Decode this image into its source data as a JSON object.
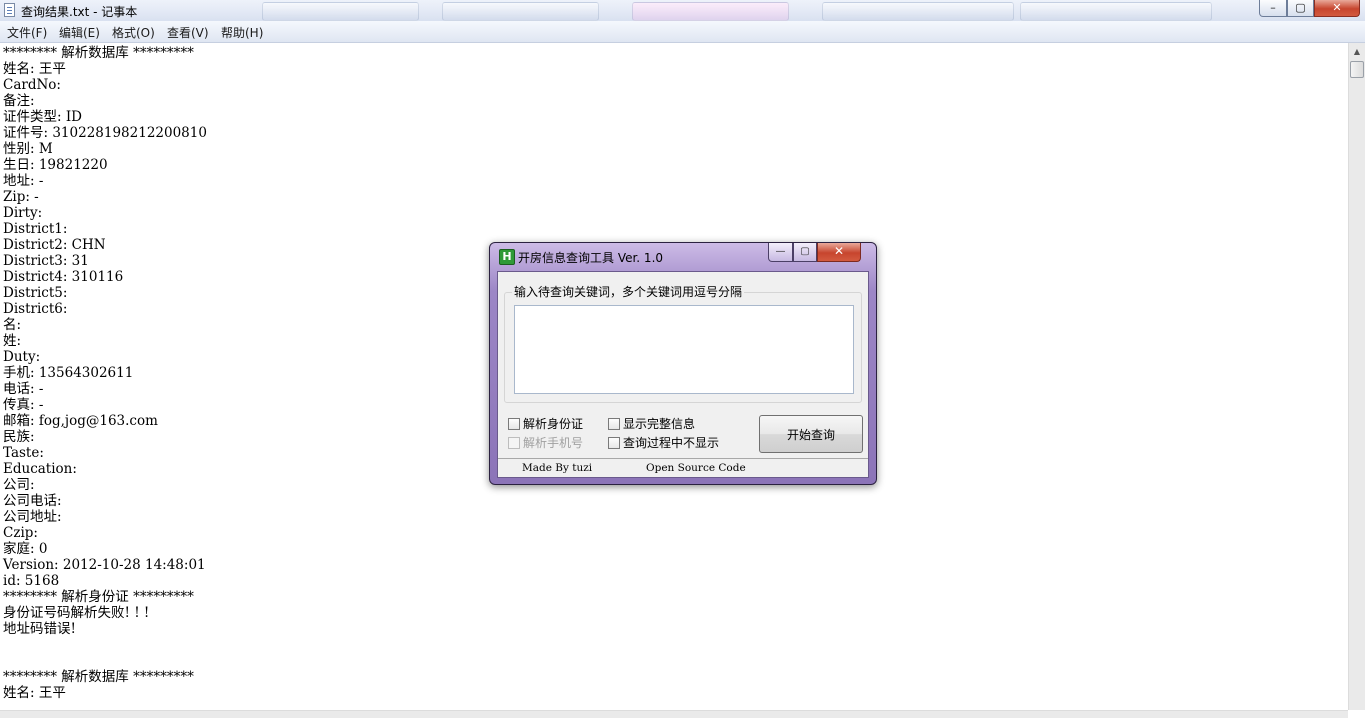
{
  "window": {
    "title": "查询结果.txt - 记事本"
  },
  "window_controls": {
    "minimize": "–",
    "maximize": "▢",
    "close": "✕"
  },
  "menu": [
    "文件(F)",
    "编辑(E)",
    "格式(O)",
    "查看(V)",
    "帮助(H)"
  ],
  "document_lines": [
    "******** 解析数据库 *********",
    "姓名: 王平",
    "CardNo:",
    "备注:",
    "证件类型: ID",
    "证件号: 310228198212200810",
    "性别: M",
    "生日: 19821220",
    "地址: -",
    "Zip: -",
    "Dirty:",
    "District1:",
    "District2: CHN",
    "District3: 31",
    "District4: 310116",
    "District5:",
    "District6:",
    "名:",
    "姓:",
    "Duty:",
    "手机: 13564302611",
    "电话: -",
    "传真: -",
    "邮箱: fog,jog@163.com",
    "民族:",
    "Taste:",
    "Education:",
    "公司:",
    "公司电话:",
    "公司地址:",
    "Czip:",
    "家庭: 0",
    "Version: 2012-10-28 14:48:01",
    "id: 5168",
    "******** 解析身份证 *********",
    "身份证号码解析失败! ! !",
    "地址码错误!",
    "",
    "",
    "******** 解析数据库 *********",
    "姓名: 王平"
  ],
  "dialog": {
    "icon_letter": "H",
    "title": "开房信息查询工具 Ver. 1.0",
    "controls": {
      "minimize": "—",
      "maximize": "▢",
      "close": "✕"
    },
    "input_label": "输入待查询关键词，多个关键词用逗号分隔",
    "input_value": "",
    "checkboxes": [
      {
        "label": "解析身份证",
        "checked": false,
        "enabled": true
      },
      {
        "label": "显示完整信息",
        "checked": false,
        "enabled": true
      },
      {
        "label": "解析手机号",
        "checked": false,
        "enabled": false
      },
      {
        "label": "查询过程中不显示",
        "checked": false,
        "enabled": true
      }
    ],
    "search_button": "开始查询",
    "status": {
      "left": "Made By tuzi",
      "right": "Open Source Code"
    }
  }
}
